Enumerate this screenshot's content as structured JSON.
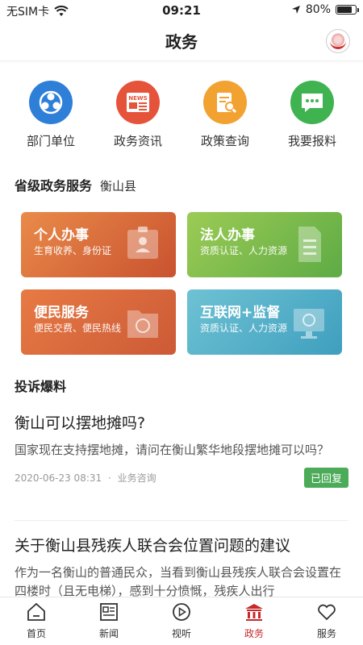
{
  "status_bar": {
    "carrier": "无SIM卡",
    "time": "09:21",
    "battery": "80%",
    "battery_level": 0.8
  },
  "header": {
    "title": "政务"
  },
  "quick_links": [
    {
      "label": "部门单位",
      "icon": "people-network-icon",
      "color": "#2e7fd8"
    },
    {
      "label": "政务资讯",
      "icon": "news-icon",
      "color": "#e5533a"
    },
    {
      "label": "政策查询",
      "icon": "document-search-icon",
      "color": "#f2a230"
    },
    {
      "label": "我要报料",
      "icon": "chat-bubble-icon",
      "color": "#3fb34f"
    }
  ],
  "services_section": {
    "title": "省级政务服务",
    "region": "衡山县"
  },
  "service_cards": [
    {
      "title": "个人办事",
      "desc": "生育收养、身份证",
      "icon": "id-card-icon"
    },
    {
      "title": "法人办事",
      "desc": "资质认证、人力资源",
      "icon": "document-icon"
    },
    {
      "title": "便民服务",
      "desc": "便民交费、便民热线",
      "icon": "folder-icon"
    },
    {
      "title": "互联网+监督",
      "desc": "资质认证、人力资源",
      "icon": "monitor-icon"
    }
  ],
  "complaints_section": {
    "title": "投诉爆料"
  },
  "posts": [
    {
      "title": "衡山可以摆地摊吗?",
      "body": "国家现在支持摆地摊，请问在衡山繁华地段摆地摊可以吗？",
      "date": "2020-06-23 08:31",
      "separator": "·",
      "category": "业务咨询",
      "status": "已回复"
    },
    {
      "title": "关于衡山县残疾人联合会位置问题的建议",
      "body": "作为一名衡山的普通民众，当看到衡山县残疾人联合会设置在四楼时（且无电梯），感到十分愤慨，残疾人出行"
    }
  ],
  "tab_bar": [
    {
      "label": "首页",
      "icon": "home-icon"
    },
    {
      "label": "新闻",
      "icon": "newspaper-icon"
    },
    {
      "label": "视听",
      "icon": "play-icon"
    },
    {
      "label": "政务",
      "icon": "government-icon",
      "active": true
    },
    {
      "label": "服务",
      "icon": "heart-icon"
    }
  ],
  "colors": {
    "accent": "#c8282a",
    "badge": "#4cab59"
  }
}
